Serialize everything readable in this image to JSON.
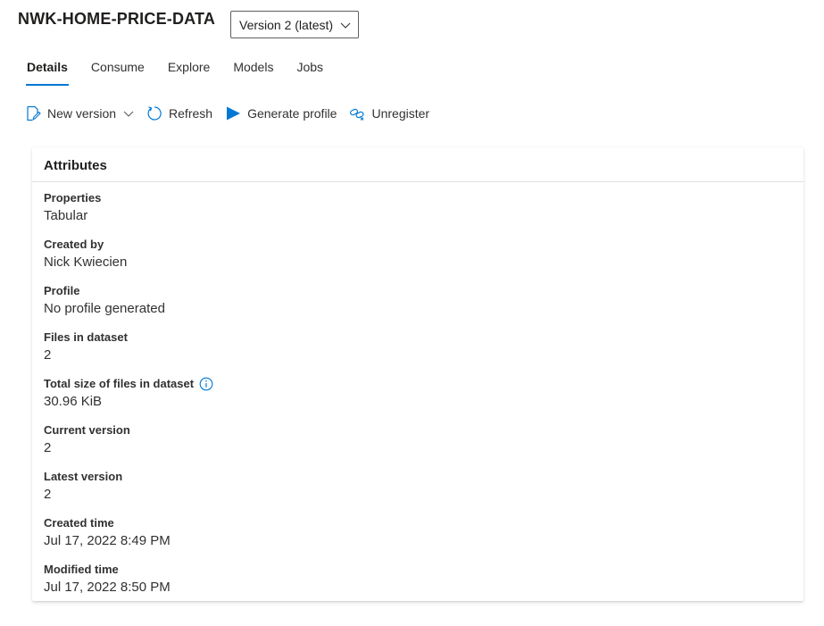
{
  "header": {
    "title": "NWK-HOME-PRICE-DATA",
    "version_select": "Version 2 (latest)"
  },
  "tabs": [
    {
      "label": "Details",
      "active": true
    },
    {
      "label": "Consume",
      "active": false
    },
    {
      "label": "Explore",
      "active": false
    },
    {
      "label": "Models",
      "active": false
    },
    {
      "label": "Jobs",
      "active": false
    }
  ],
  "toolbar": {
    "new_version": "New version",
    "refresh": "Refresh",
    "generate_profile": "Generate profile",
    "unregister": "Unregister"
  },
  "card": {
    "title": "Attributes",
    "attributes": [
      {
        "label": "Properties",
        "value": "Tabular"
      },
      {
        "label": "Created by",
        "value": "Nick Kwiecien"
      },
      {
        "label": "Profile",
        "value": "No profile generated"
      },
      {
        "label": "Files in dataset",
        "value": "2"
      },
      {
        "label": "Total size of files in dataset",
        "value": "30.96 KiB"
      },
      {
        "label": "Current version",
        "value": "2"
      },
      {
        "label": "Latest version",
        "value": "2"
      },
      {
        "label": "Created time",
        "value": "Jul 17, 2022 8:49 PM"
      },
      {
        "label": "Modified time",
        "value": "Jul 17, 2022 8:50 PM"
      }
    ]
  },
  "colors": {
    "accent": "#0078d4",
    "text": "#201f1e",
    "border": "#e1dfdd"
  },
  "icons": {
    "new_version": "edit-document-icon",
    "refresh": "refresh-icon",
    "generate_profile": "play-icon",
    "unregister": "unlink-icon",
    "info": "info-icon",
    "dropdown": "chevron-down-icon"
  }
}
